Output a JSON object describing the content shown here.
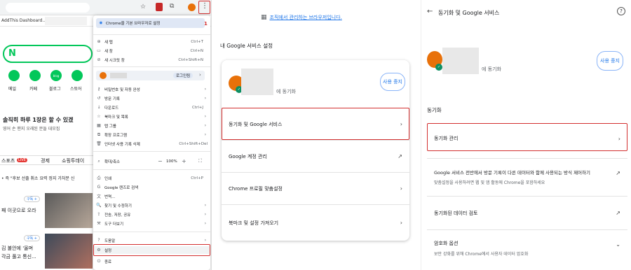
{
  "left": {
    "bookmark": "AddThis Dashboard...",
    "naver": {
      "logo": "N",
      "shortcuts": [
        "메일",
        "카페",
        "블로그",
        "스토어"
      ],
      "headline": "솔직히 하루 1장은 할 수 있겠",
      "subline": "영어 손 맨지 오래된 분들 대모집",
      "tabs": [
        "스포츠",
        "LIVE",
        "경제",
        "쇼핑투데이"
      ],
      "news_top": "• 즉 \"후보 선출 취소 요력 정지 가처분 신",
      "subscribe": "구독 +",
      "news1": "패 이곳으로 오라",
      "news2a": "김 불안에 '올며",
      "news2b": "각금 풀고 통신..."
    },
    "annotation": "1",
    "menu": {
      "default_browser": "Chrome을 기본 브라우저로 설정",
      "items": [
        {
          "icon": "⊕",
          "label": "새 탭",
          "shortcut": "Ctrl+T"
        },
        {
          "icon": "▭",
          "label": "새 창",
          "shortcut": "Ctrl+N"
        },
        {
          "icon": "⊘",
          "label": "새 시크릿 창",
          "shortcut": "Ctrl+Shift+N"
        }
      ],
      "profile_login": "로그인됨",
      "items2": [
        {
          "icon": "⚷",
          "label": "비밀번호 및 자동 완성",
          "arrow": "›"
        },
        {
          "icon": "↺",
          "label": "방문 기록",
          "arrow": "›"
        },
        {
          "icon": "↓",
          "label": "다운로드",
          "shortcut": "Ctrl+J"
        },
        {
          "icon": "☆",
          "label": "북마크 및 목록",
          "arrow": "›"
        },
        {
          "icon": "▦",
          "label": "탭 그룹",
          "arrow": "›"
        },
        {
          "icon": "⧉",
          "label": "확장 프로그램",
          "arrow": "›"
        },
        {
          "icon": "🗑",
          "label": "인터넷 사용 기록 삭제",
          "shortcut": "Ctrl+Shift+Del"
        }
      ],
      "zoom_label": "확대/축소",
      "zoom_minus": "−",
      "zoom_value": "100%",
      "zoom_plus": "+",
      "items3": [
        {
          "icon": "⎙",
          "label": "인쇄",
          "shortcut": "Ctrl+P"
        },
        {
          "icon": "G",
          "label": "Google 렌즈로 검색"
        },
        {
          "icon": "文",
          "label": "번역..."
        },
        {
          "icon": "🔍",
          "label": "찾기 및 수정하기",
          "arrow": "›"
        },
        {
          "icon": "⇪",
          "label": "전송, 저장, 공유",
          "arrow": "›"
        },
        {
          "icon": "⚒",
          "label": "도구 더보기",
          "arrow": "›"
        }
      ],
      "help": "도움말",
      "settings": "설정",
      "exit": "종료"
    }
  },
  "middle": {
    "managed_notice": "조직에서 관리하는 브라우저입니다.",
    "section_title": "내 Google 서비스 설정",
    "sync_status": "에 동기화",
    "stop_sync": "사용 중지",
    "rows": [
      {
        "label": "동기화 및 Google 서비스",
        "icon": "›"
      },
      {
        "label": "Google 계정 관리",
        "icon": "↗"
      },
      {
        "label": "Chrome 프로필 맞춤설정",
        "icon": "›"
      },
      {
        "label": "북마크 및 설정 가져오기",
        "icon": "›"
      }
    ]
  },
  "right": {
    "back": "←",
    "title": "동기화 및 Google 서비스",
    "help_icon": "?",
    "sync_status": "에 동기화",
    "stop_sync": "사용 중지",
    "section": "동기화",
    "manage_sync": "동기화 관리",
    "google_services_title": "Google 서비스 전반에서 방문 기록이 다른 데이터와 함께 사용되는 방식 제어하기",
    "google_services_sub": "맞춤설정을 사용하려면 웹 및 앱 활동에 Chrome을 포함하세요",
    "review_data": "동기화된 데이터 검토",
    "encryption_title": "암호화 옵션",
    "encryption_sub": "보안 강화를 위해 Chrome에서 사용자 데이터 암호화"
  }
}
